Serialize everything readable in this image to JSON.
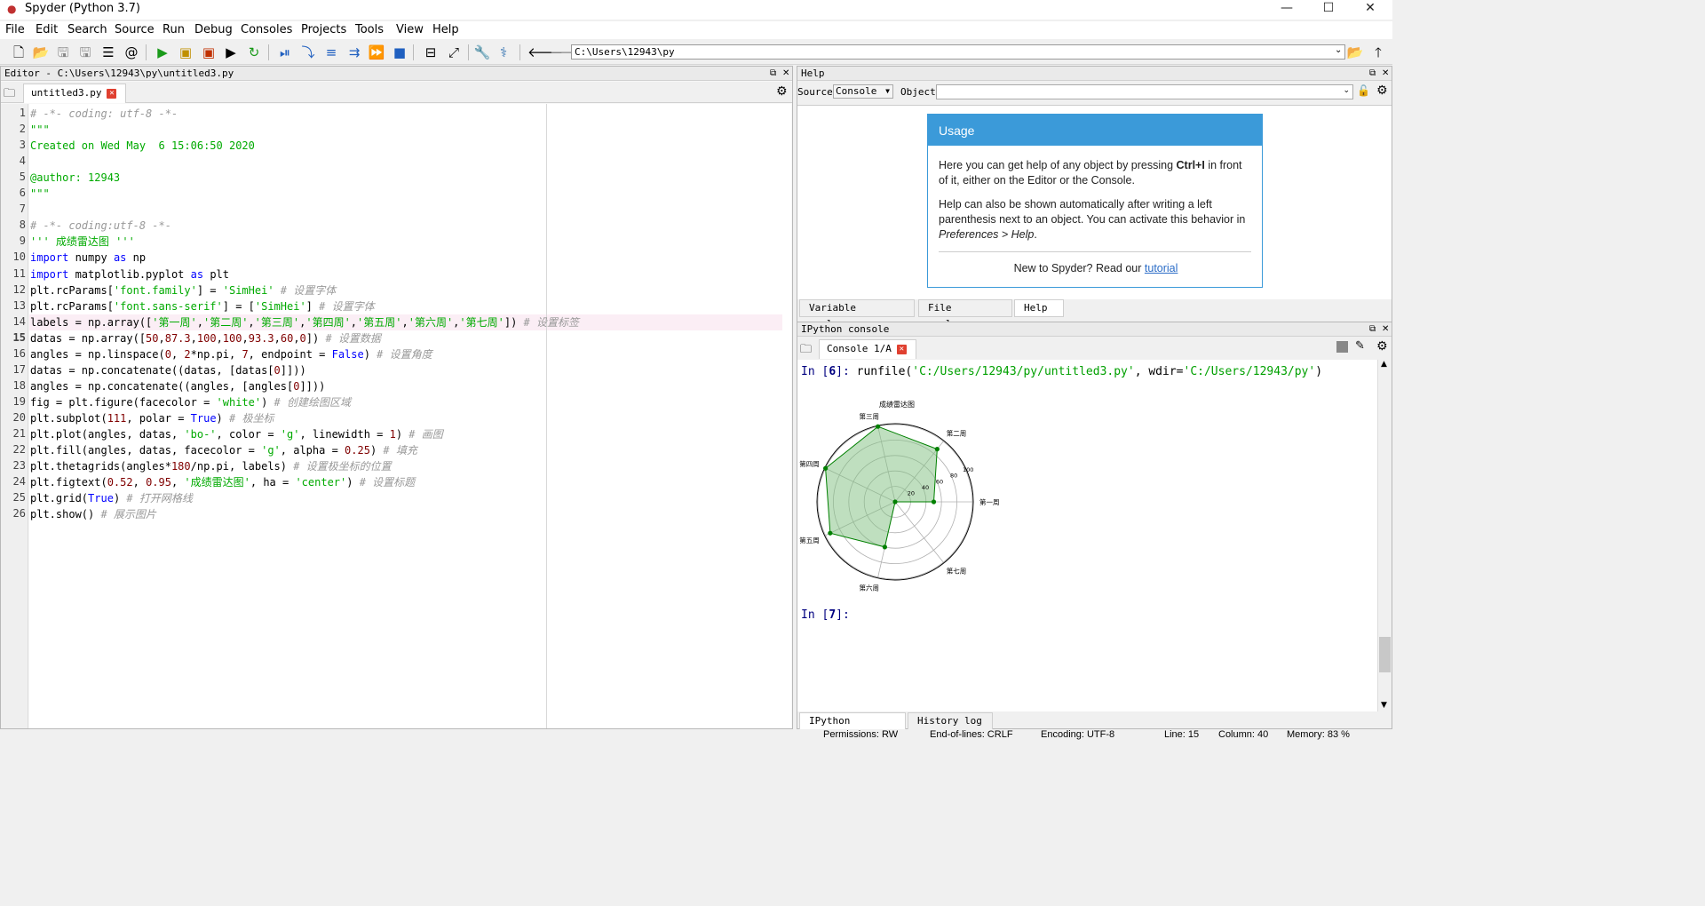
{
  "window": {
    "title": "Spyder (Python 3.7)",
    "minimize": "—",
    "maximize": "☐",
    "close": "✕"
  },
  "menubar": [
    "File",
    "Edit",
    "Search",
    "Source",
    "Run",
    "Debug",
    "Consoles",
    "Projects",
    "Tools",
    "View",
    "Help"
  ],
  "toolbar": {
    "path": "C:\\Users\\12943\\py"
  },
  "editor": {
    "header": "Editor - C:\\Users\\12943\\py\\untitled3.py",
    "tab": "untitled3.py",
    "current_line": 15
  },
  "code": [
    [
      [
        "cm",
        "# -*- coding: utf-8 -*-"
      ]
    ],
    [
      [
        "st",
        "\"\"\""
      ]
    ],
    [
      [
        "st",
        "Created on Wed May  6 15:06:50 2020"
      ]
    ],
    [
      [
        "st",
        ""
      ]
    ],
    [
      [
        "st",
        "@author: 12943"
      ]
    ],
    [
      [
        "st",
        "\"\"\""
      ]
    ],
    [
      [
        "",
        ""
      ]
    ],
    [
      [
        "cm",
        "# -*- coding:utf-8 -*-"
      ]
    ],
    [
      [
        "st",
        "''' 成绩雷达图 '''"
      ]
    ],
    [
      [
        "kw",
        "import"
      ],
      [
        "",
        " numpy "
      ],
      [
        "kw",
        "as"
      ],
      [
        "",
        " np"
      ]
    ],
    [
      [
        "kw",
        "import"
      ],
      [
        "",
        " matplotlib.pyplot "
      ],
      [
        "kw",
        "as"
      ],
      [
        "",
        " plt"
      ]
    ],
    [
      [
        "",
        "plt.rcParams["
      ],
      [
        "st",
        "'font.family'"
      ],
      [
        "",
        "] = "
      ],
      [
        "st",
        "'SimHei'"
      ],
      [
        "",
        " "
      ],
      [
        "cm",
        "# 设置字体"
      ]
    ],
    [
      [
        "",
        "plt.rcParams["
      ],
      [
        "st",
        "'font.sans-serif'"
      ],
      [
        "",
        "] = ["
      ],
      [
        "st",
        "'SimHei'"
      ],
      [
        "",
        "] "
      ],
      [
        "cm",
        "# 设置字体"
      ]
    ],
    [
      [
        "",
        "labels = np.array(["
      ],
      [
        "st",
        "'第一周'"
      ],
      [
        "",
        ","
      ],
      [
        "st",
        "'第二周'"
      ],
      [
        "",
        ","
      ],
      [
        "st",
        "'第三周'"
      ],
      [
        "",
        ","
      ],
      [
        "st",
        "'第四周'"
      ],
      [
        "",
        ","
      ],
      [
        "st",
        "'第五周'"
      ],
      [
        "",
        ","
      ],
      [
        "st",
        "'第六周'"
      ],
      [
        "",
        ","
      ],
      [
        "st",
        "'第七周'"
      ],
      [
        "",
        "]) "
      ],
      [
        "cm",
        "# 设置标签"
      ]
    ],
    [
      [
        "",
        "datas = np.array(["
      ],
      [
        "nm",
        "50"
      ],
      [
        "",
        ","
      ],
      [
        "nm",
        "87.3"
      ],
      [
        "",
        ","
      ],
      [
        "nm",
        "100"
      ],
      [
        "",
        ","
      ],
      [
        "nm",
        "100"
      ],
      [
        "",
        ","
      ],
      [
        "nm",
        "93.3"
      ],
      [
        "",
        ","
      ],
      [
        "nm",
        "60"
      ],
      [
        "",
        ","
      ],
      [
        "nm",
        "0"
      ],
      [
        "",
        "]) "
      ],
      [
        "cm",
        "# 设置数据"
      ]
    ],
    [
      [
        "",
        "angles = np.linspace("
      ],
      [
        "nm",
        "0"
      ],
      [
        "",
        ", "
      ],
      [
        "nm",
        "2"
      ],
      [
        "",
        "*np.pi, "
      ],
      [
        "nm",
        "7"
      ],
      [
        "",
        ", endpoint = "
      ],
      [
        "kw",
        "False"
      ],
      [
        "",
        ") "
      ],
      [
        "cm",
        "# 设置角度"
      ]
    ],
    [
      [
        "",
        "datas = np.concatenate((datas, [datas["
      ],
      [
        "nm",
        "0"
      ],
      [
        "",
        "]]))"
      ]
    ],
    [
      [
        "",
        "angles = np.concatenate((angles, [angles["
      ],
      [
        "nm",
        "0"
      ],
      [
        "",
        "]]))"
      ]
    ],
    [
      [
        "",
        "fig = plt.figure(facecolor = "
      ],
      [
        "st",
        "'white'"
      ],
      [
        "",
        ") "
      ],
      [
        "cm",
        "# 创建绘图区域"
      ]
    ],
    [
      [
        "",
        "plt.subplot("
      ],
      [
        "nm",
        "111"
      ],
      [
        "",
        ", polar = "
      ],
      [
        "kw",
        "True"
      ],
      [
        "",
        ") "
      ],
      [
        "cm",
        "# 极坐标"
      ]
    ],
    [
      [
        "",
        "plt.plot(angles, datas, "
      ],
      [
        "st",
        "'bo-'"
      ],
      [
        "",
        ", color = "
      ],
      [
        "st",
        "'g'"
      ],
      [
        "",
        ", linewidth = "
      ],
      [
        "nm",
        "1"
      ],
      [
        "",
        ") "
      ],
      [
        "cm",
        "# 画图"
      ]
    ],
    [
      [
        "",
        "plt.fill(angles, datas, facecolor = "
      ],
      [
        "st",
        "'g'"
      ],
      [
        "",
        ", alpha = "
      ],
      [
        "nm",
        "0.25"
      ],
      [
        "",
        ") "
      ],
      [
        "cm",
        "# 填充"
      ]
    ],
    [
      [
        "",
        "plt.thetagrids(angles*"
      ],
      [
        "nm",
        "180"
      ],
      [
        "",
        "/np.pi, labels) "
      ],
      [
        "cm",
        "# 设置极坐标的位置"
      ]
    ],
    [
      [
        "",
        "plt.figtext("
      ],
      [
        "nm",
        "0.52"
      ],
      [
        "",
        ", "
      ],
      [
        "nm",
        "0.95"
      ],
      [
        "",
        ", "
      ],
      [
        "st",
        "'成绩雷达图'"
      ],
      [
        "",
        ", ha = "
      ],
      [
        "st",
        "'center'"
      ],
      [
        "",
        ") "
      ],
      [
        "cm",
        "# 设置标题"
      ]
    ],
    [
      [
        "",
        "plt.grid("
      ],
      [
        "kw",
        "True"
      ],
      [
        "",
        ") "
      ],
      [
        "cm",
        "# 打开网格线"
      ]
    ],
    [
      [
        "",
        "plt.show() "
      ],
      [
        "cm",
        "# 展示图片"
      ]
    ]
  ],
  "help": {
    "header": "Help",
    "source_label": "Source",
    "source_value": "Console",
    "object_label": "Object",
    "usage_title": "Usage",
    "p1a": "Here you can get help of any object by pressing ",
    "p1b": "Ctrl+I",
    "p1c": " in front of it, either on the Editor or the Console.",
    "p2a": "Help can also be shown automatically after writing a left parenthesis next to an object. You can activate this behavior in ",
    "p2b": "Preferences > Help",
    ".p2c": ".",
    "p2end": ".",
    "new_text": "New to Spyder? Read our ",
    "tutorial": "tutorial",
    "tabs": [
      "Variable explorer",
      "File explorer",
      "Help"
    ]
  },
  "ipython": {
    "header": "IPython console",
    "tab": "Console 1/A",
    "in6_prompt": "In [",
    "in6_num": "6",
    "in6_close": "]: ",
    "in6_pre": "runfile(",
    "in6_arg1": "'C:/Users/12943/py/untitled3.py'",
    "in6_mid": ", wdir=",
    "in6_arg2": "'C:/Users/12943/py'",
    "in6_end": ")",
    "in7_prompt": "In [",
    "in7_num": "7",
    "in7_close": "]:",
    "tabs": [
      "IPython console",
      "History log"
    ]
  },
  "chart_data": {
    "type": "radar",
    "title": "成绩雷达图",
    "categories": [
      "第一周",
      "第二周",
      "第三周",
      "第四周",
      "第五周",
      "第六周",
      "第七周"
    ],
    "values": [
      50,
      87.3,
      100,
      100,
      93.3,
      60,
      0
    ],
    "rlim": [
      0,
      100
    ],
    "r_ticks": [
      20,
      40,
      60,
      80,
      100
    ],
    "color": "#008000",
    "fill_color": "#80c080"
  },
  "statusbar": {
    "permissions": "Permissions: RW",
    "eol": "End-of-lines: CRLF",
    "encoding": "Encoding: UTF-8",
    "line": "Line: 15",
    "column": "Column: 40",
    "memory": "Memory: 83 %"
  }
}
